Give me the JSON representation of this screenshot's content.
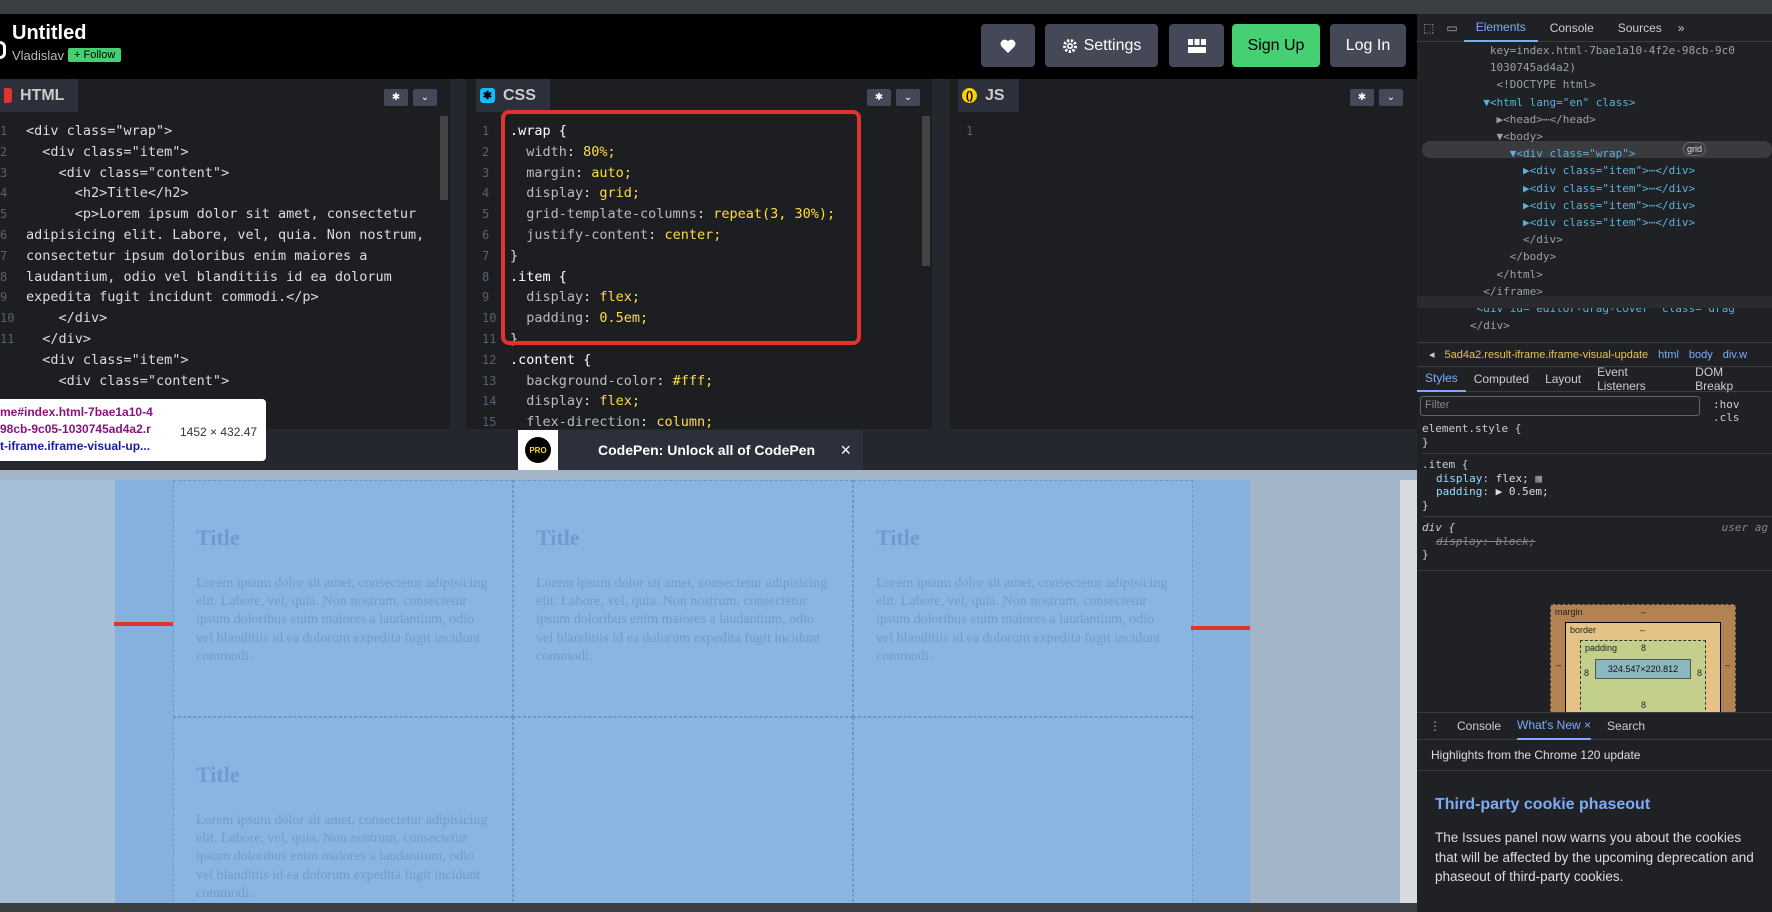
{
  "header": {
    "title": "Untitled",
    "author": "Vladislav",
    "follow_label": "+ Follow",
    "settings_label": "Settings",
    "signup_label": "Sign Up",
    "login_label": "Log In"
  },
  "editors": {
    "html": {
      "label": "HTML",
      "lines": [
        "1",
        "2",
        "3",
        "4",
        "5",
        "",
        "",
        "",
        "6",
        "7",
        "8",
        "9",
        "10",
        "11"
      ],
      "code": [
        "<div class=\"wrap\">",
        "  <div class=\"item\">",
        "    <div class=\"content\">",
        "      <h2>Title</h2>",
        "      <p>Lorem ipsum dolor sit amet, consectetur",
        "adipisicing elit. Labore, vel, quia. Non nostrum,",
        "consectetur ipsum doloribus enim maiores a",
        "laudantium, odio vel blanditiis id ea dolorum",
        "expedita fugit incidunt commodi.</p>",
        "    </div>",
        "  </div>",
        "",
        "  <div class=\"item\">",
        "    <div class=\"content\">"
      ]
    },
    "css": {
      "label": "CSS",
      "lines": [
        "1",
        "2",
        "3",
        "4",
        "5",
        "6",
        "7",
        "8",
        "9",
        "10",
        "11",
        "12",
        "13",
        "14",
        "15"
      ],
      "code": [
        ".wrap {",
        "  width: 80%;",
        "  margin: auto;",
        "  display: grid;",
        "  grid-template-columns: repeat(3, 30%);",
        "  justify-content: center;",
        "}",
        ".item {",
        "  display: flex;",
        "  padding: 0.5em;",
        "}",
        ".content {",
        "  background-color: #fff;",
        "  display: flex;",
        "  flex-direction: column;"
      ]
    },
    "js": {
      "label": "JS",
      "lines": [
        "1"
      ]
    }
  },
  "inspector_tooltip": {
    "selector_lines": [
      "me#index.html-7bae1a10-4",
      "98cb-9c05-1030745ad4a2.r",
      "t-iframe.iframe-visual-up..."
    ],
    "dimensions": "1452 × 432.47"
  },
  "pro_banner": {
    "logo_text": "PRO",
    "text": "CodePen: Unlock all of CodePen",
    "close": "×"
  },
  "preview": {
    "items": [
      {
        "title": "Title",
        "text": "Lorem ipsum dolor sit amet, consectetur adipisicing elit. Labore, vel, quia. Non nostrum, consectetur ipsum doloribus enim maiores a laudantium, odio vel blanditiis id ea dolorum expedita fugit incidunt commodi."
      },
      {
        "title": "Title",
        "text": "Lorem ipsum dolor sit amet, consectetur adipisicing elit. Labore, vel, quia. Non nostrum, consectetur ipsum doloribus enim maiores a laudantium, odio vel blanditiis id ea dolorum expedita fugit incidunt commodi."
      },
      {
        "title": "Title",
        "text": "Lorem ipsum dolor sit amet, consectetur adipisicing elit. Labore, vel, quia. Non nostrum, consectetur ipsum doloribus enim maiores a laudantium, odio vel blanditiis id ea dolorum expedita fugit incidunt commodi."
      },
      {
        "title": "Title",
        "text": "Lorem ipsum dolor sit amet, consectetur adipisicing elit. Labore, vel, quia. Non nostrum, consectetur ipsum doloribus enim maiores a laudantium, odio vel blanditiis id ea dolorum expedita fugit incidunt commodi."
      }
    ]
  },
  "devtools": {
    "tabs": [
      "Elements",
      "Console",
      "Sources"
    ],
    "more": "»",
    "tree": [
      "           key=index.html-7bae1a10-4f2e-98cb-9c0",
      "           1030745ad4a2)",
      "            <!DOCTYPE html>",
      "          ▼<html lang=\"en\" class>",
      "            ▶<head>⋯</head>",
      "            ▼<body>",
      "              ▼<div class=\"wrap\">",
      "                ▶<div class=\"item\">⋯</div>",
      "                ▶<div class=\"item\">⋯</div>",
      "                ▶<div class=\"item\">⋯</div>",
      "                ▶<div class=\"item\">⋯</div>",
      "                </div>",
      "              </body>",
      "            </html>",
      "          </iframe>",
      "         <div id=\"editor-drag-cover\" class=\"drag",
      "        </div>"
    ],
    "grid_badge": "grid",
    "crumbs": [
      "5ad4a2.result-iframe.iframe-visual-update",
      "html",
      "body",
      "div.w"
    ],
    "style_tabs": [
      "Styles",
      "Computed",
      "Layout",
      "Event Listeners",
      "DOM Breakp"
    ],
    "filter_placeholder": "Filter",
    "hov": ":hov  .cls",
    "rules": {
      "element_style": "element.style {",
      "item_selector": ".item {",
      "item_display_prop": "display",
      "item_display_val": "flex;",
      "item_padding_prop": "padding",
      "item_padding_val": "▶ 0.5em;",
      "div_selector": "div {",
      "div_source": "user ag",
      "div_display": "display: block;",
      "close": "}"
    },
    "box_model": {
      "margin_label": "margin",
      "margin_val": "–",
      "border_label": "border",
      "border_val": "–",
      "padding_label": "padding",
      "padding_val": "8",
      "content": "324.547×220.812",
      "dash": "–"
    },
    "drawer_tabs": [
      "Console",
      "What's New",
      "Search"
    ],
    "drawer_close": "×",
    "highlights": "Highlights from the Chrome 120 update",
    "news_title": "Third-party cookie phaseout",
    "news_text": "The Issues panel now warns you about the cookies that will be affected by the upcoming deprecation and phaseout of third-party cookies."
  }
}
